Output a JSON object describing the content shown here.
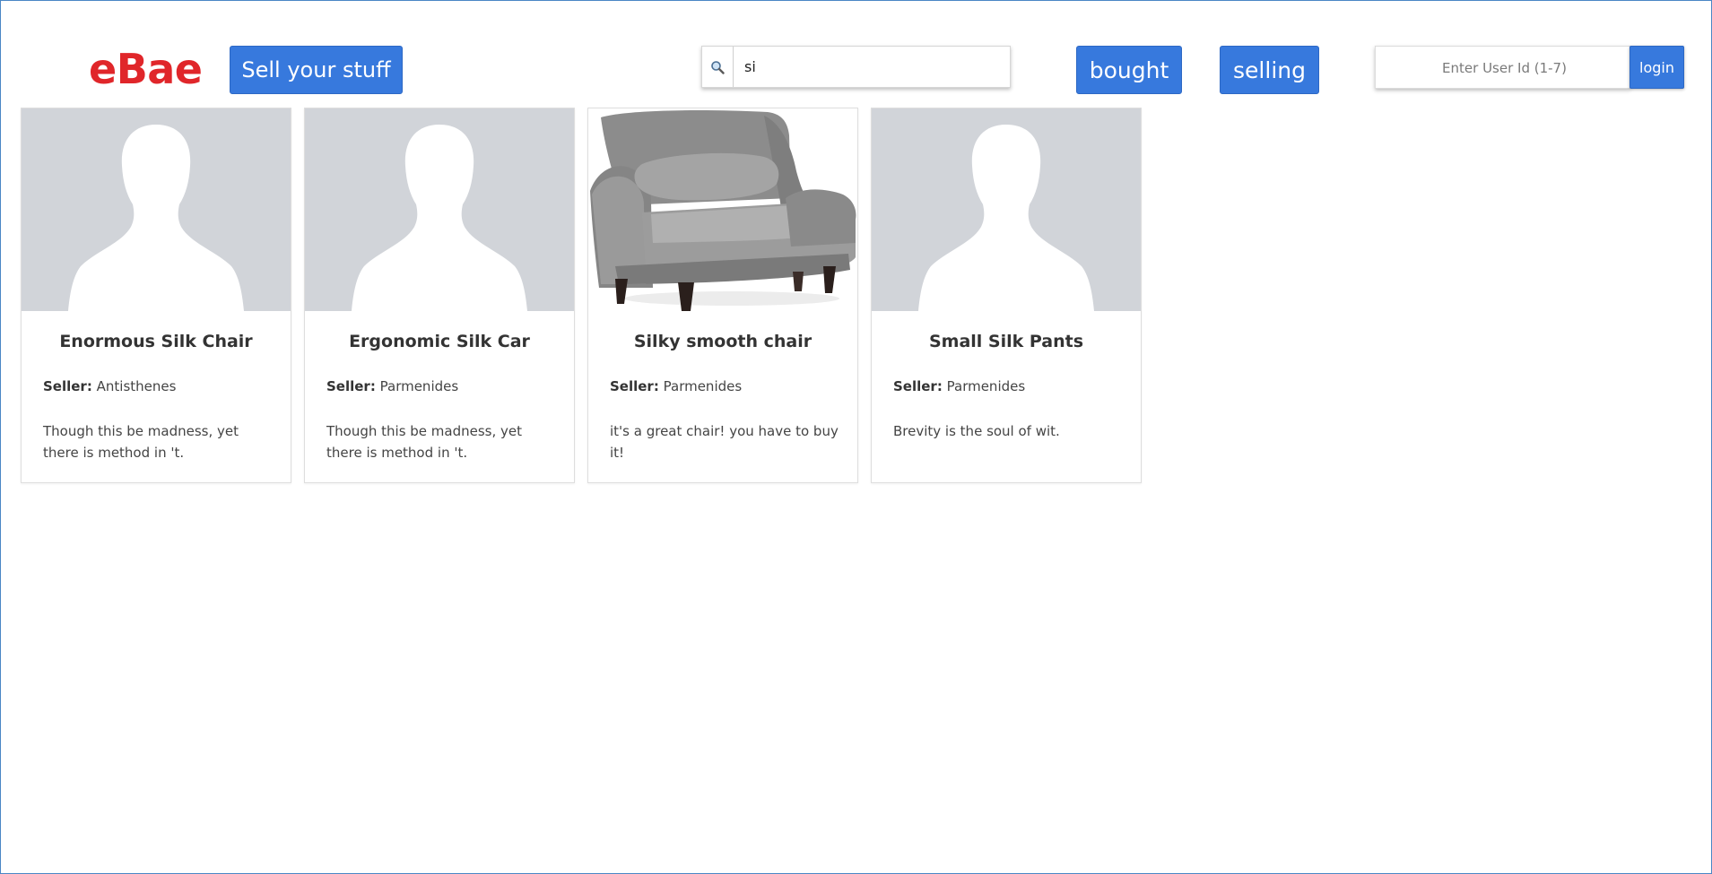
{
  "header": {
    "logo": "eBae",
    "sell_label": "Sell your stuff",
    "search_value": "si",
    "bought_label": "bought",
    "selling_label": "selling",
    "userid_placeholder": "Enter User Id (1-7)",
    "login_label": "login"
  },
  "colors": {
    "logo": "#e0262a",
    "button": "#3779dd",
    "placeholder_bg": "#d1d4d9"
  },
  "icons": {
    "search": "magnifier-icon",
    "avatar_placeholder": "person-silhouette-icon",
    "chair": "armchair-image"
  },
  "items": [
    {
      "title": "Enormous Silk Chair",
      "seller_label": "Seller:",
      "seller": "Antisthenes",
      "description": "Though this be madness, yet there is method in 't.",
      "image": "placeholder"
    },
    {
      "title": "Ergonomic Silk Car",
      "seller_label": "Seller:",
      "seller": "Parmenides",
      "description": "Though this be madness, yet there is method in 't.",
      "image": "placeholder"
    },
    {
      "title": "Silky smooth chair",
      "seller_label": "Seller:",
      "seller": "Parmenides",
      "description": "it's a great chair! you have to buy it!",
      "image": "chair"
    },
    {
      "title": "Small Silk Pants",
      "seller_label": "Seller:",
      "seller": "Parmenides",
      "description": "Brevity is the soul of wit.",
      "image": "placeholder"
    }
  ]
}
